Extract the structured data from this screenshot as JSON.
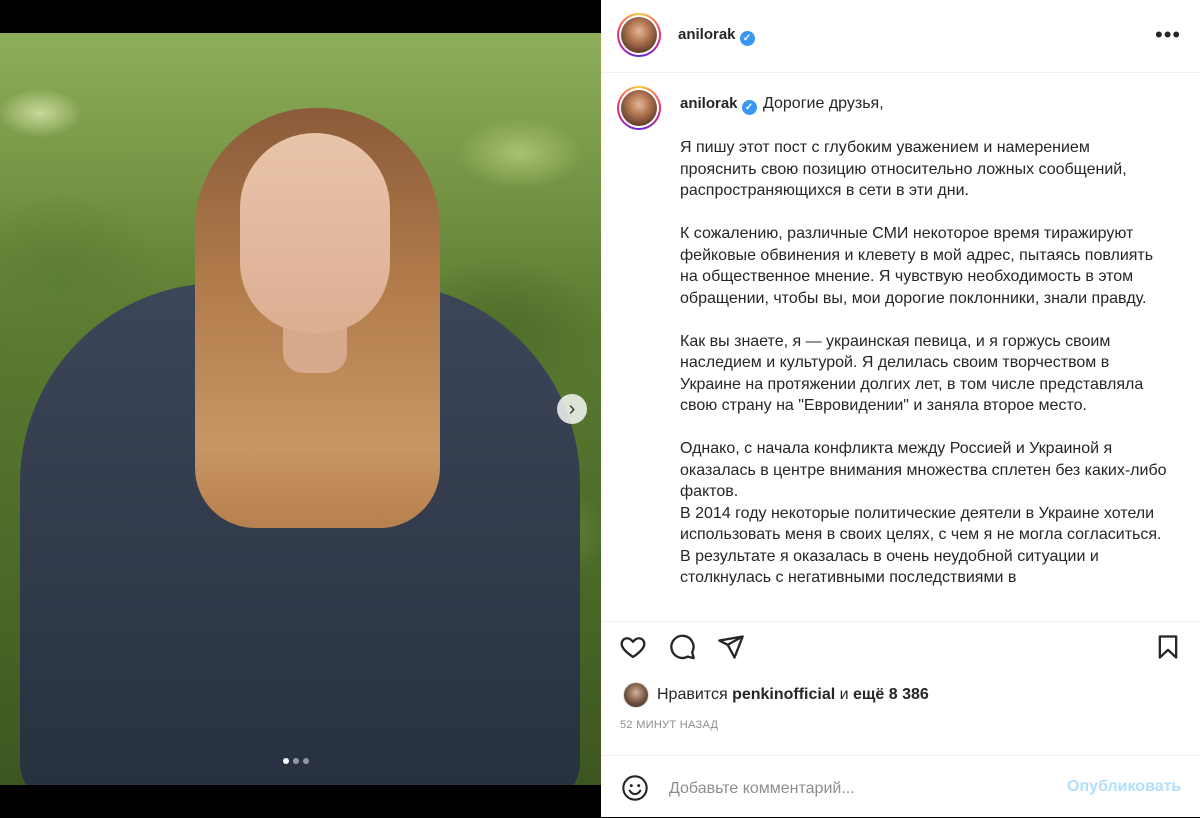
{
  "post": {
    "username": "anilorak",
    "verified": true,
    "more_label": "•••"
  },
  "caption": {
    "username": "anilorak",
    "greeting": "Дорогие друзья,",
    "paragraphs": [
      "Я пишу этот пост с глубоким уважением и намерением прояснить свою позицию относительно ложных сообщений, распространяющихся в сети в эти дни.",
      "К сожалению, различные СМИ некоторое время тиражируют фейковые обвинения и клевету в мой адрес, пытаясь повлиять на общественное мнение. Я чувствую необходимость в этом обращении, чтобы вы, мои дорогие поклонники, знали правду.",
      "Как вы знаете, я — украинская певица, и я горжусь своим наследием и культурой. Я делилась своим творчеством в Украине на протяжении долгих лет, в том числе представляла свою страну на \"Евровидении\" и заняла второе место.",
      "Однако, с начала конфликта между Россией и Украиной я оказалась в центре внимания множества сплетен без каких-либо фактов.",
      "В 2014 году некоторые политические деятели в Украине хотели использовать меня в своих целях, с чем я не могла согласиться. В результате я оказалась в очень неудобной ситуации и столкнулась с негативными последствиями в"
    ]
  },
  "likes": {
    "prefix": "Нравится",
    "user": "penkinofficial",
    "middle": "и",
    "count": "ещё 8 386"
  },
  "time_ago": "52 МИНУТ НАЗАД",
  "comment": {
    "placeholder": "Добавьте комментарий...",
    "publish_label": "Опубликовать"
  },
  "carousel": {
    "total": 3,
    "current": 1,
    "next_glyph": "›"
  },
  "colors": {
    "accent": "#3897f0",
    "publish_disabled": "#b2dffc",
    "muted": "#8e8e8e"
  }
}
